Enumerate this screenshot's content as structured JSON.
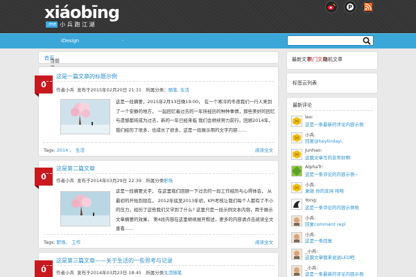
{
  "header": {
    "logo_text": "xiáobīng",
    "logo_me": ".me",
    "logo_cn": "小 兵 跑 江 湖",
    "social": [
      "weibo-icon",
      "pinterest-icon",
      "rss-icon"
    ]
  },
  "nav": {
    "items": [
      "iDesign",
      "·"
    ],
    "search_placeholder": ""
  },
  "breadcrumb": {
    "text": "当前位置：",
    "link": "首页"
  },
  "posts": [
    {
      "count": "0",
      "title": "这是一篇文章的标题示例",
      "meta_author": "作者小兵",
      "meta_date": "发布于2015年02月20日 21:31",
      "meta_cat_label": "所属分类：",
      "meta_cat": "随笔, 生活",
      "excerpt": "这是一段摘要，2015年2月13日晚19:00， 在一个寒冷的冬夜我们一行人来到了一个安静的地方， 一起回忆着过去的一年所经历的种种事情，那些美好的回忆与遗憾都将成为过去，新的一年已经来临 我们会继续努力前行。回顾2014年，我们经历了很多，也成长了很多，这是一段展示用的文字内容……",
      "tags_label": "Tags:",
      "tags": "2014 ， 生活",
      "more": "阅读全文"
    },
    {
      "count": "0",
      "title": "这是第二篇文章",
      "meta_author": "作者小兵",
      "meta_date": "发布于2014年03月29日 22:39",
      "meta_cat_label": "所属分类",
      "meta_cat": "职场",
      "excerpt": "这是一段摘要文字， 在这里我们回顾一下过去的一段工作经历与心得体会， 从最初的开始到现在， 2012年底至2013年初，KPI考核让我们每个人都有了不小的压力，经历了这些我们又学到了什么? 这里只是一段示例文本内容，用于展示文章摘要的效果， 第4段内容在这里继续展开叙述，更多的内容请点击阅读全文查看……",
      "tags_label": "Tags:",
      "tags": "职场， 工作",
      "more": "阅读全文"
    },
    {
      "count": "0",
      "title": "这是第三篇文章——关于生活的一些思考与记录",
      "meta_author": "作者小兵",
      "meta_date": "发布于2014年03月23日 18:45",
      "meta_cat_label": "所属分类",
      "meta_cat": "生活随笔"
    }
  ],
  "sidebar": {
    "tabs": [
      "最新文章",
      "热门文章",
      "随机文章"
    ],
    "active_tab": 1,
    "box2_title": "标签云列表",
    "comments_title": "最新评论",
    "comments": [
      {
        "name": "leo:",
        "text": "这是一条最新的评论内容示例",
        "avatar": "yellow"
      },
      {
        "name": "小兵:",
        "text": "回复@heylindayi.",
        "avatar": "yellow"
      },
      {
        "name": "Junhao:",
        "text": "这篇文章写的非常好啊",
        "avatar": "yellow"
      },
      {
        "name": "AlphaTr:",
        "text": "这是一条评论的内容示例~",
        "avatar": "green"
      },
      {
        "name": "小兵:",
        "text": "谢谢 你的支持 哈哈",
        "avatar": "yellow"
      },
      {
        "name": "Yong:",
        "text": "这是一条评论的内容示例哈",
        "avatar": "dark"
      },
      {
        "name": "小兵:",
        "text": "回复comment repl",
        "avatar": "face"
      },
      {
        "name": "小兵:",
        "text": "这是一条回复",
        "avatar": "face"
      },
      {
        "name": "_小兵:",
        "text": "这篇文章我来说说LED吧",
        "avatar": "face"
      },
      {
        "name": "_小兵:",
        "text": "这是一条最新的评论内容示例",
        "avatar": "face"
      }
    ]
  },
  "colors": {
    "accent": "#3ba6d8",
    "ribbon": "#c9181e",
    "link": "#2b8fcf",
    "header": "#333333"
  }
}
